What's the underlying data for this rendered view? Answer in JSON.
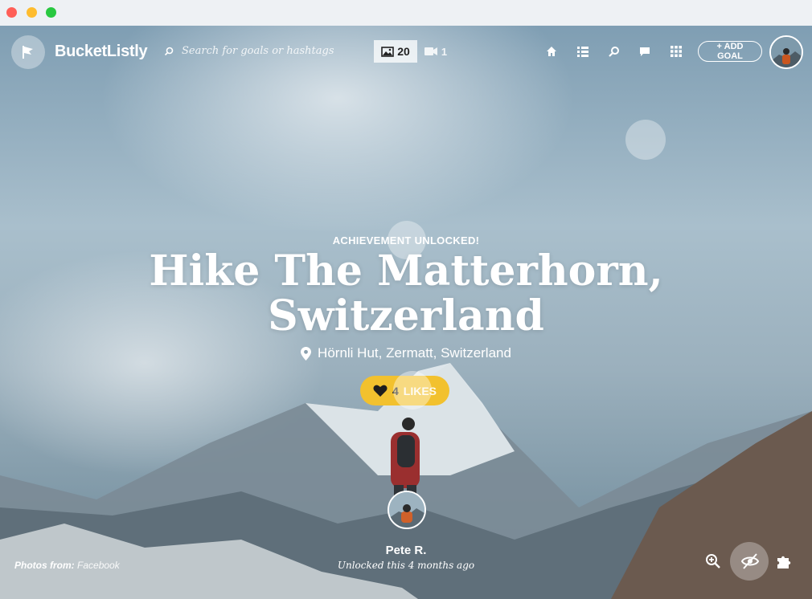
{
  "window": {
    "controls": [
      "close",
      "minimize",
      "maximize"
    ]
  },
  "header": {
    "brand": "BucketListly",
    "search_placeholder": "Search for goals or hashtags",
    "photo_count": "20",
    "video_count": "1",
    "nav_icons": [
      "home-icon",
      "list-icon",
      "search-icon",
      "chat-icon",
      "apps-grid-icon"
    ],
    "add_goal_label": "+ ADD GOAL"
  },
  "hero": {
    "kicker": "ACHIEVEMENT UNLOCKED!",
    "title": "Hike The Matterhorn, Switzerland",
    "location": "Hörnli Hut, Zermatt, Switzerland",
    "likes_count": "4",
    "likes_label": "LIKES"
  },
  "author": {
    "name": "Pete R.",
    "meta": "Unlocked this 4 months ago"
  },
  "footer": {
    "photos_from_label": "Photos from:",
    "photos_from_source": "Facebook",
    "tool_icons": [
      "zoom-in-icon",
      "hide-eye-icon",
      "puzzle-icon"
    ]
  },
  "colors": {
    "like_button": "#f2c12e",
    "text": "#ffffff"
  }
}
